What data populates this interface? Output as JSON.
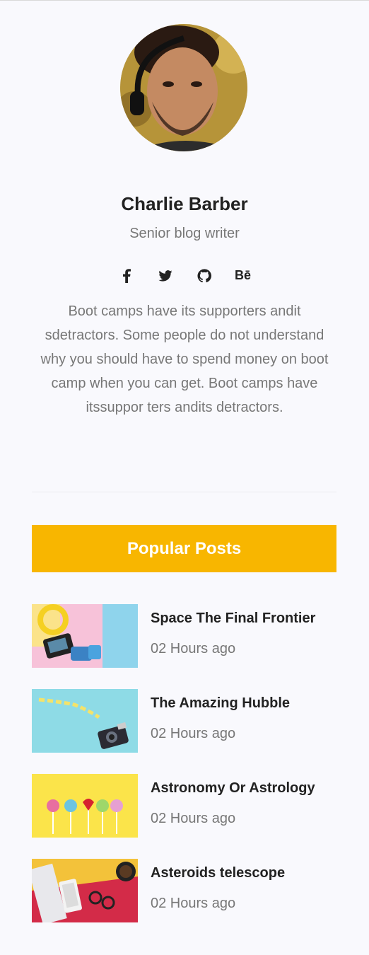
{
  "profile": {
    "name": "Charlie Barber",
    "role": "Senior blog writer",
    "bio": "Boot camps have its supporters andit sdetractors. Some people do not understand why you should have to spend money on boot camp when you can get. Boot camps have itssuppor ters andits detractors.",
    "socials": [
      {
        "icon": "facebook-icon"
      },
      {
        "icon": "twitter-icon"
      },
      {
        "icon": "github-icon"
      },
      {
        "icon": "behance-icon",
        "label": "Bē"
      }
    ]
  },
  "popular": {
    "heading": "Popular Posts",
    "accent": "#f8b600",
    "posts": [
      {
        "title": "Space The Final Frontier",
        "time": "02 Hours ago"
      },
      {
        "title": "The Amazing Hubble",
        "time": "02 Hours ago"
      },
      {
        "title": "Astronomy Or Astrology",
        "time": "02 Hours ago"
      },
      {
        "title": "Asteroids telescope",
        "time": "02 Hours ago"
      }
    ]
  }
}
